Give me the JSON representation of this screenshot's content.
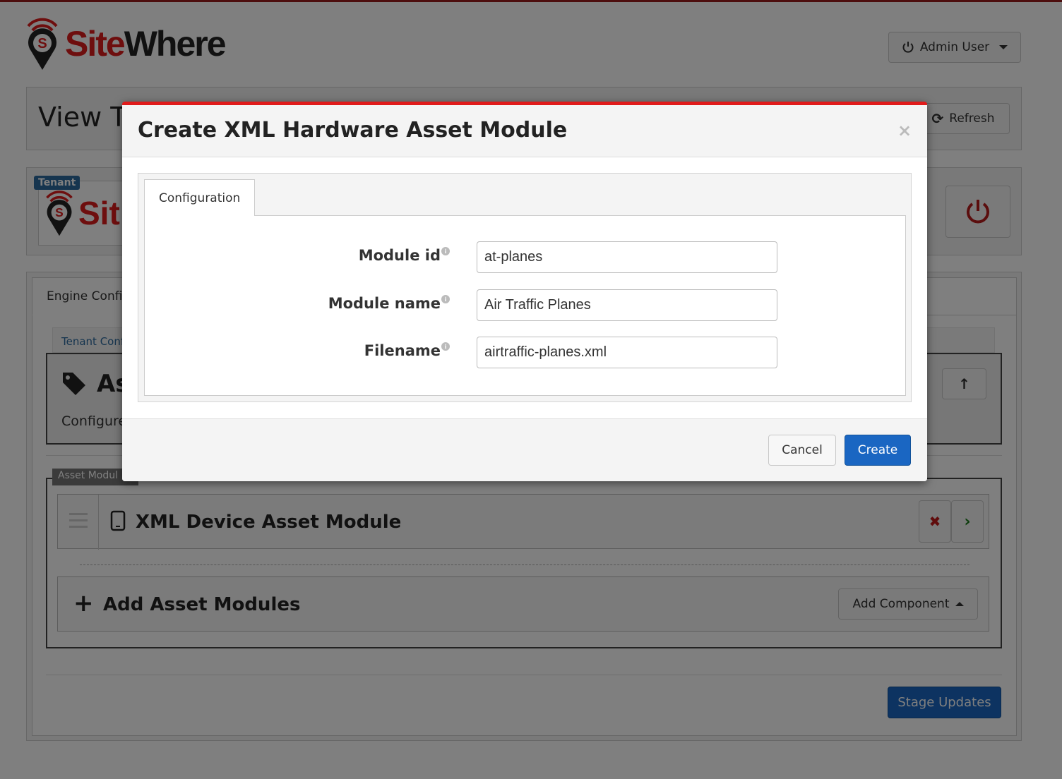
{
  "brand": {
    "name_part1": "Site",
    "name_part2": "Where"
  },
  "header": {
    "user_menu_label": "Admin User"
  },
  "view": {
    "title": "View T",
    "refresh_label": "Refresh"
  },
  "tenant": {
    "badge": "Tenant",
    "logo_text": "Sit"
  },
  "engine": {
    "tab_label": "Engine Confi",
    "breadcrumb": "Tenant Conf",
    "section_title": "As",
    "section_description": "Configure",
    "modules_label": "Asset Modul",
    "modules": [
      {
        "title": "XML Device Asset Module",
        "icon": "mobile-device-icon"
      }
    ],
    "add_row_label": "Add Asset Modules",
    "add_component_label": "Add Component",
    "stage_updates_label": "Stage Updates"
  },
  "modal": {
    "title": "Create XML Hardware Asset Module",
    "close_glyph": "×",
    "tab_label": "Configuration",
    "fields": [
      {
        "label": "Module id",
        "value": "at-planes"
      },
      {
        "label": "Module name",
        "value": "Air Traffic Planes"
      },
      {
        "label": "Filename",
        "value": "airtraffic-planes.xml"
      }
    ],
    "cancel_label": "Cancel",
    "create_label": "Create"
  },
  "colors": {
    "brand_red": "#dd1c1c",
    "primary_blue": "#1a66c2",
    "badge_blue": "#2d6a9f"
  }
}
